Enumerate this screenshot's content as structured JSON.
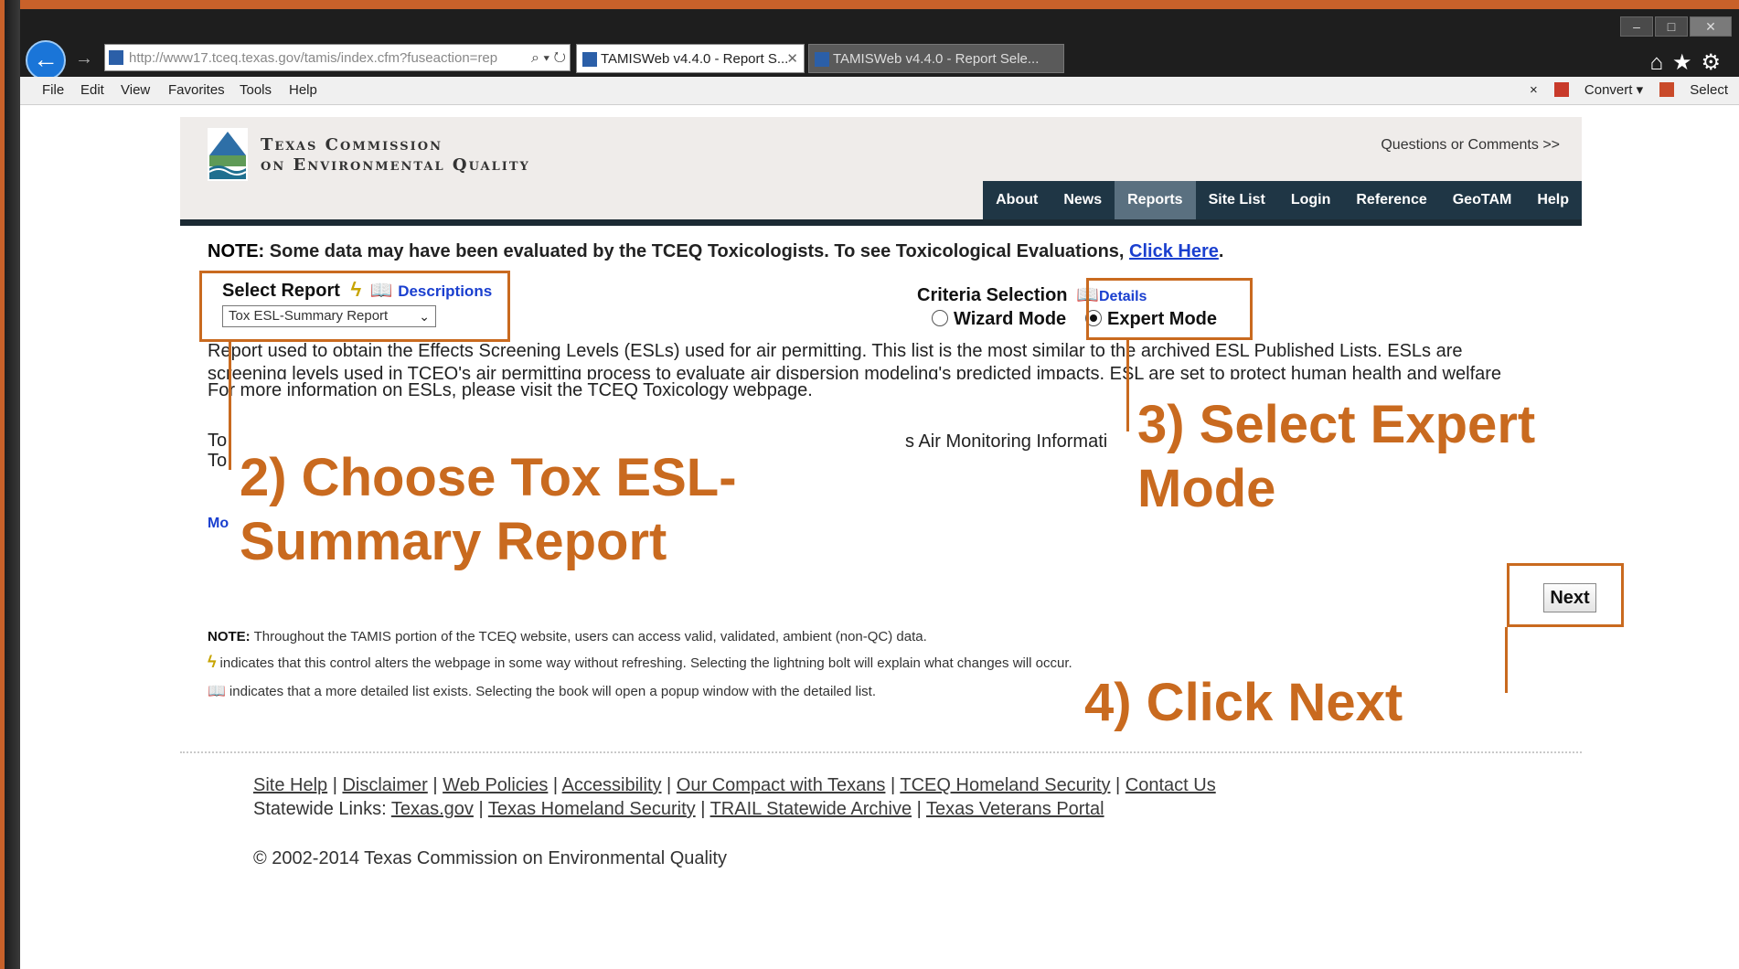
{
  "browser": {
    "address_url": "http://www17.tceq.texas.gov/tamis/index.cfm?fuseaction=rep",
    "address_host": "texas.gov",
    "tabs": [
      {
        "label": "TAMISWeb v4.4.0 - Report S...",
        "active": true
      },
      {
        "label": "TAMISWeb v4.4.0 - Report Sele...",
        "active": false
      }
    ],
    "menu": [
      "File",
      "Edit",
      "View",
      "Favorites",
      "Tools",
      "Help"
    ],
    "toolbar_right": {
      "close": "×",
      "convert": "Convert",
      "select": "Select"
    }
  },
  "site": {
    "org_line1": "Texas Commission",
    "org_line2": "on Environmental Quality",
    "questions_link": "Questions or Comments >>",
    "nav": [
      "About",
      "News",
      "Reports",
      "Site List",
      "Login",
      "Reference",
      "GeoTAM",
      "Help"
    ],
    "nav_active": "Reports"
  },
  "note": {
    "label": "NOTE:",
    "text": " Some data may have been evaluated by the TCEQ Toxicologists. To see Toxicological Evaluations, ",
    "link": "Click Here",
    "end": "."
  },
  "report": {
    "select_label": "Select Report",
    "descriptions_link": "Descriptions",
    "selected_value": "Tox ESL-Summary Report",
    "criteria_label": "Criteria Selection",
    "details_link": "Details",
    "wizard_mode": "Wizard Mode",
    "expert_mode": "Expert Mode",
    "selected_mode": "expert"
  },
  "description": {
    "line1": "Report used to obtain the Effects Screening Levels (ESLs) used for air permitting. This list is the most similar to the archived ESL Published Lists. ESLs are",
    "line2": "screening levels used in TCEQ's air permitting process to evaluate air dispersion modeling's predicted impacts. ESL are set to protect human health and welfare",
    "line3": "For more information on ESLs, please visit the TCEQ Toxicology webpage.",
    "partial_left1": "To",
    "partial_left2": "To",
    "partial_mid": "s Air Monitoring Informati",
    "partial_link": "Mo"
  },
  "next_button": "Next",
  "notes": {
    "note_label": "NOTE:",
    "note_text": " Throughout the TAMIS portion of the TCEQ website, users can access valid, validated, ambient (non-QC) data.",
    "bolt_text": "indicates that this control alters the webpage in some way without refreshing. Selecting the lightning bolt will explain what changes will occur.",
    "book_text": "indicates that a more detailed list exists. Selecting the book will open a popup window with the detailed list."
  },
  "footer": {
    "links_row1": [
      "Site Help",
      "Disclaimer",
      "Web Policies",
      "Accessibility",
      "Our Compact with Texans",
      "TCEQ Homeland Security",
      "Contact Us"
    ],
    "statewide_label": "Statewide Links: ",
    "links_row2": [
      "Texas.gov",
      "Texas Homeland Security",
      "TRAIL Statewide Archive",
      "Texas Veterans Portal"
    ],
    "copyright": "© 2002-2014 Texas Commission on Environmental Quality"
  },
  "annotations": {
    "step2_line1": "2) Choose Tox ESL-",
    "step2_line2": "Summary Report",
    "step3_line1": "3) Select Expert",
    "step3_line2": "Mode",
    "step4": "4) Click Next",
    "color": "#c96a1f"
  }
}
